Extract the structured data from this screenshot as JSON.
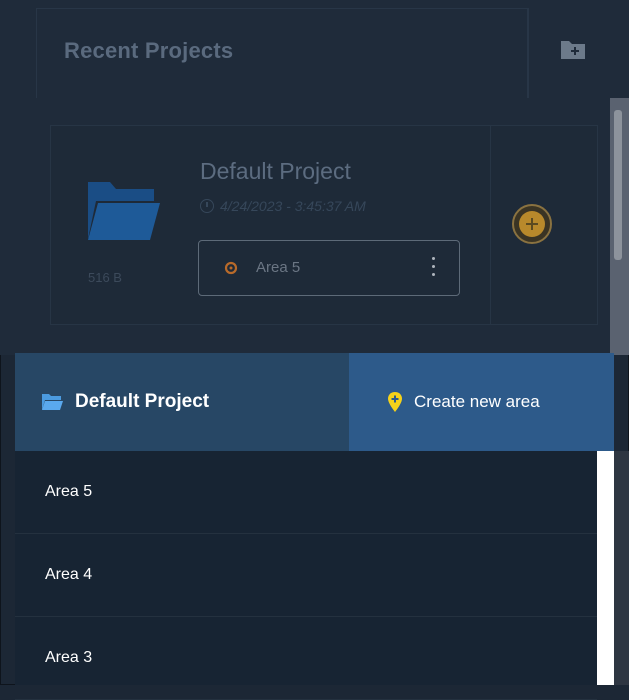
{
  "recent_projects": {
    "title": "Recent Projects",
    "project": {
      "name": "Default Project",
      "date": "4/24/2023 - 3:45:37 AM",
      "size": "516 B",
      "selected_area": "Area 5"
    }
  },
  "popup": {
    "project_title": "Default Project",
    "create_label": "Create new area",
    "areas": [
      "Area 5",
      "Area 4",
      "Area 3"
    ]
  },
  "colors": {
    "accent_blue": "#2d5a8a",
    "header_blue": "#274765",
    "pin_yellow": "#f5d21a",
    "folder_blue": "#1d5a9e"
  }
}
